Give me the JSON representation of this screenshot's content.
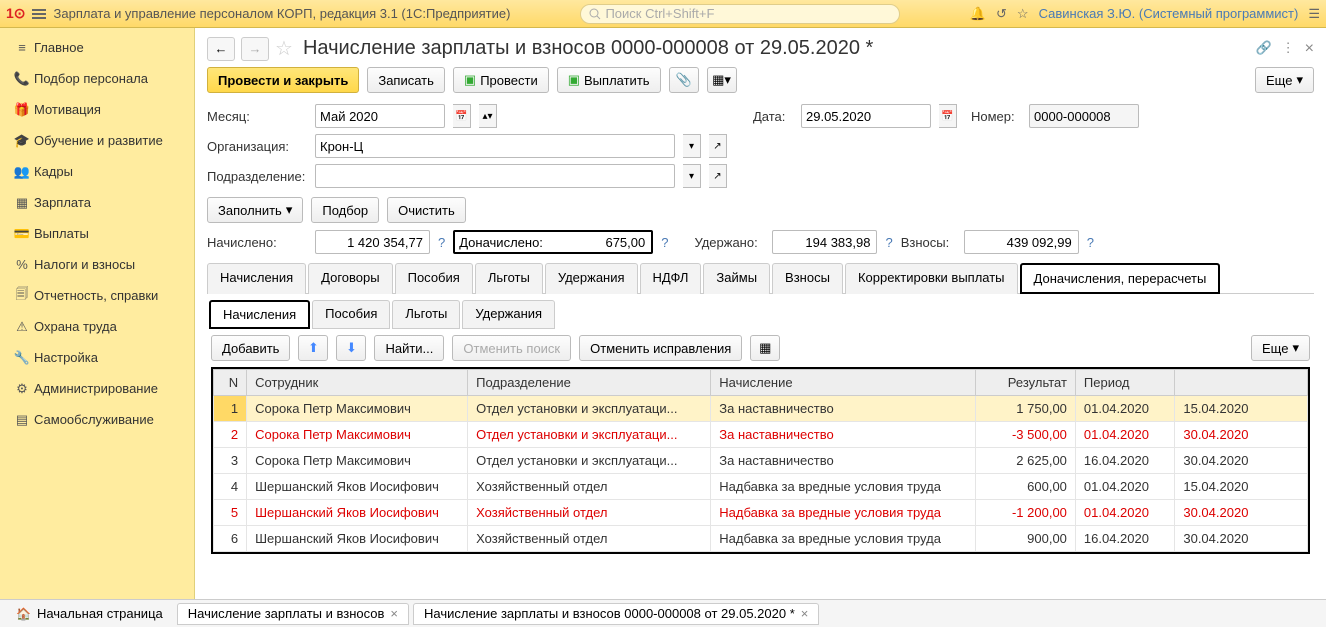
{
  "top": {
    "title": "Зарплата и управление персоналом КОРП, редакция 3.1  (1С:Предприятие)",
    "search_placeholder": "Поиск Ctrl+Shift+F",
    "user": "Савинская З.Ю. (Системный программист)"
  },
  "sidebar": [
    {
      "icon": "≡",
      "label": "Главное"
    },
    {
      "icon": "📞",
      "label": "Подбор персонала"
    },
    {
      "icon": "🎁",
      "label": "Мотивация"
    },
    {
      "icon": "🎓",
      "label": "Обучение и развитие"
    },
    {
      "icon": "👥",
      "label": "Кадры"
    },
    {
      "icon": "▦",
      "label": "Зарплата"
    },
    {
      "icon": "💳",
      "label": "Выплаты"
    },
    {
      "icon": "%",
      "label": "Налоги и взносы"
    },
    {
      "icon": "🗐",
      "label": "Отчетность, справки"
    },
    {
      "icon": "⚠",
      "label": "Охрана труда"
    },
    {
      "icon": "🔧",
      "label": "Настройка"
    },
    {
      "icon": "⚙",
      "label": "Администрирование"
    },
    {
      "icon": "▤",
      "label": "Самообслуживание"
    }
  ],
  "doc": {
    "title": "Начисление зарплаты и взносов 0000-000008 от 29.05.2020 *"
  },
  "buttons": {
    "post_close": "Провести и закрыть",
    "save": "Записать",
    "post": "Провести",
    "pay": "Выплатить",
    "more": "Еще",
    "fill": "Заполнить",
    "select": "Подбор",
    "clear": "Очистить",
    "add": "Добавить",
    "find": "Найти...",
    "cancel_search": "Отменить поиск",
    "cancel_fix": "Отменить исправления"
  },
  "form": {
    "month_lbl": "Месяц:",
    "month": "Май 2020",
    "date_lbl": "Дата:",
    "date": "29.05.2020",
    "number_lbl": "Номер:",
    "number": "0000-000008",
    "org_lbl": "Организация:",
    "org": "Крон-Ц",
    "dept_lbl": "Подразделение:",
    "dept": ""
  },
  "totals": {
    "accrued_lbl": "Начислено:",
    "accrued": "1 420 354,77",
    "extra_lbl": "Доначислено:",
    "extra": "675,00",
    "withheld_lbl": "Удержано:",
    "withheld": "194 383,98",
    "contrib_lbl": "Взносы:",
    "contrib": "439 092,99"
  },
  "tabs1": [
    "Начисления",
    "Договоры",
    "Пособия",
    "Льготы",
    "Удержания",
    "НДФЛ",
    "Займы",
    "Взносы",
    "Корректировки выплаты",
    "Доначисления, перерасчеты"
  ],
  "tabs2": [
    "Начисления",
    "Пособия",
    "Льготы",
    "Удержания"
  ],
  "table": {
    "headers": {
      "n": "N",
      "emp": "Сотрудник",
      "dept": "Подразделение",
      "calc": "Начисление",
      "res": "Результат",
      "per": "Период"
    },
    "rows": [
      {
        "n": "1",
        "emp": "Сорока Петр Максимович",
        "dept": "Отдел установки и эксплуатаци...",
        "calc": "За наставничество",
        "res": "1 750,00",
        "p1": "01.04.2020",
        "p2": "15.04.2020",
        "red": false,
        "sel": true
      },
      {
        "n": "2",
        "emp": "Сорока Петр Максимович",
        "dept": "Отдел установки и эксплуатаци...",
        "calc": "За наставничество",
        "res": "-3 500,00",
        "p1": "01.04.2020",
        "p2": "30.04.2020",
        "red": true
      },
      {
        "n": "3",
        "emp": "Сорока Петр Максимович",
        "dept": "Отдел установки и эксплуатаци...",
        "calc": "За наставничество",
        "res": "2 625,00",
        "p1": "16.04.2020",
        "p2": "30.04.2020",
        "red": false
      },
      {
        "n": "4",
        "emp": "Шершанский Яков Иосифович",
        "dept": "Хозяйственный отдел",
        "calc": "Надбавка за вредные условия труда",
        "res": "600,00",
        "p1": "01.04.2020",
        "p2": "15.04.2020",
        "red": false
      },
      {
        "n": "5",
        "emp": "Шершанский Яков Иосифович",
        "dept": "Хозяйственный отдел",
        "calc": "Надбавка за вредные условия труда",
        "res": "-1 200,00",
        "p1": "01.04.2020",
        "p2": "30.04.2020",
        "red": true
      },
      {
        "n": "6",
        "emp": "Шершанский Яков Иосифович",
        "dept": "Хозяйственный отдел",
        "calc": "Надбавка за вредные условия труда",
        "res": "900,00",
        "p1": "16.04.2020",
        "p2": "30.04.2020",
        "red": false
      }
    ]
  },
  "bottom_tabs": {
    "home": "Начальная страница",
    "t1": "Начисление зарплаты и взносов",
    "t2": "Начисление зарплаты и взносов 0000-000008 от 29.05.2020 *"
  }
}
